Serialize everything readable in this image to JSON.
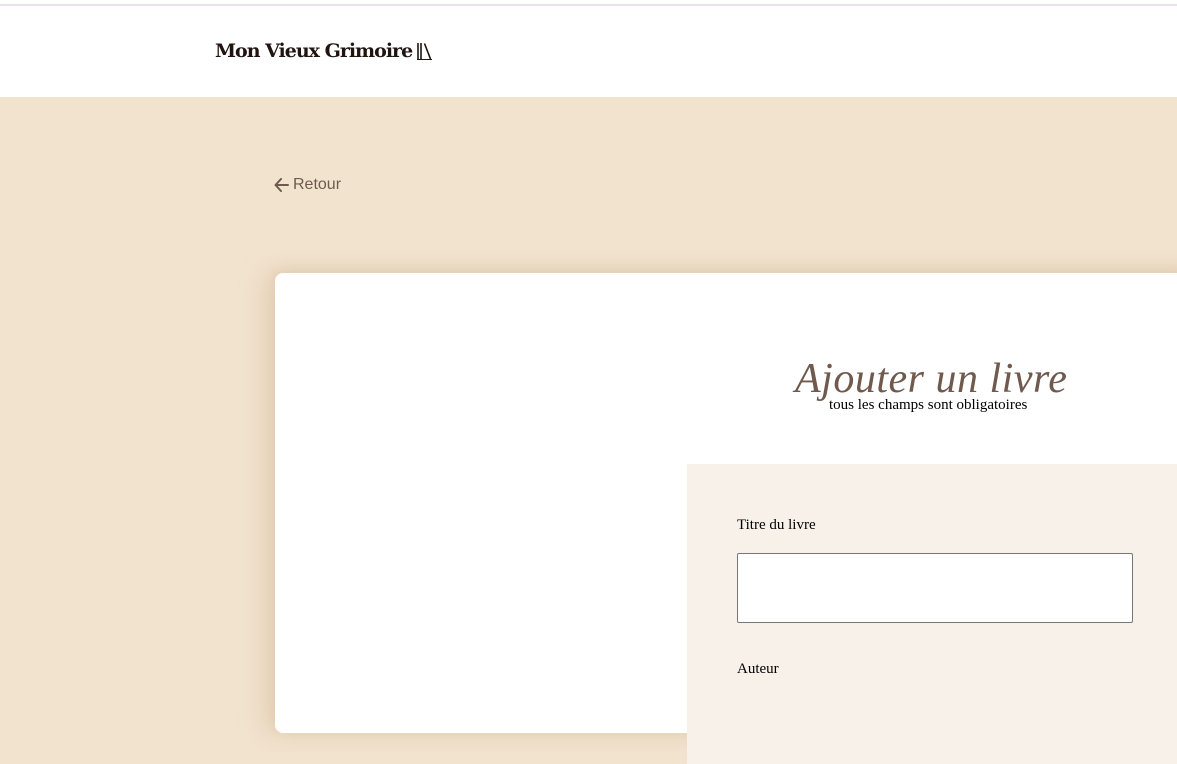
{
  "header": {
    "logo_text": "Mon Vieux Grimoire",
    "logo_icon": "books-icon"
  },
  "nav": {
    "back_label": "Retour",
    "back_icon": "arrow-left-icon"
  },
  "form": {
    "title": "Ajouter un livre",
    "subtitle": "tous les champs sont obligatoires",
    "fields": [
      {
        "label": "Titre du livre",
        "value": "",
        "placeholder": ""
      },
      {
        "label": "Auteur"
      }
    ]
  },
  "colors": {
    "page_background": "#f2e3cf",
    "header_background": "#ffffff",
    "form_panel_background": "#f7f1ea",
    "accent_text": "#6f5a4d",
    "logo_text": "#1f1410"
  }
}
